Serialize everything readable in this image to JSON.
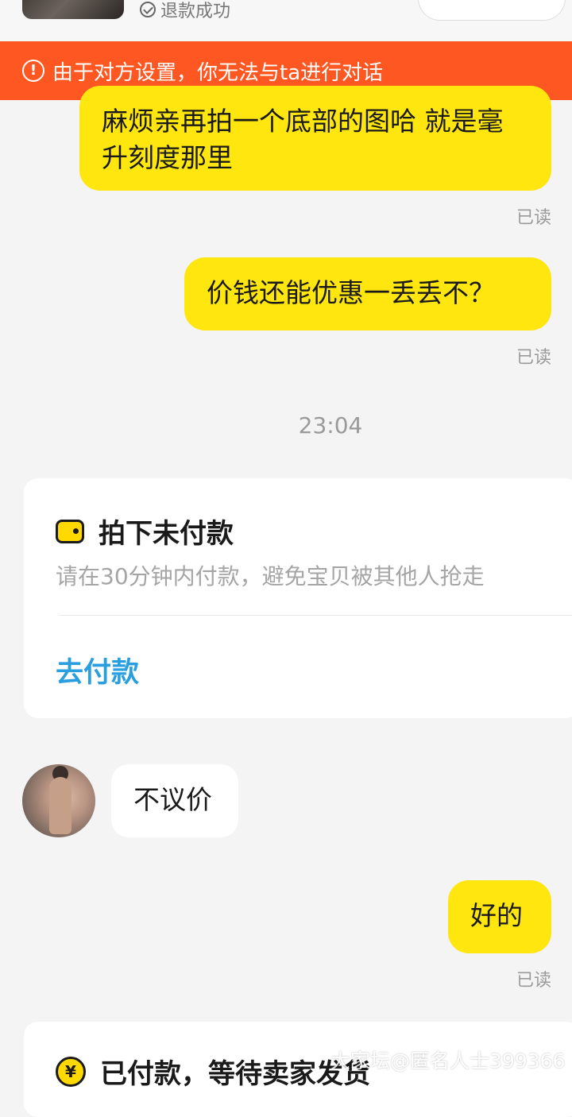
{
  "header": {
    "refund_status": "退款成功"
  },
  "warning_banner": {
    "text": "由于对方设置，你无法与ta进行对话",
    "icon": "alert-circle-icon"
  },
  "messages": [
    {
      "side": "out",
      "text": "麻烦亲再拍一个底部的图哈 就是毫升刻度那里",
      "status": "已读"
    },
    {
      "side": "out",
      "text": "价钱还能优惠一丢丢不？",
      "status": "已读"
    },
    {
      "timestamp": "23:04"
    },
    {
      "card": "order",
      "icon": "wallet-icon",
      "title": "拍下未付款",
      "subtitle": "请在30分钟内付款，避免宝贝被其他人抢走",
      "action": "去付款"
    },
    {
      "side": "in",
      "text": "不议价",
      "avatar": "seller-avatar"
    },
    {
      "side": "out",
      "text": "好的",
      "status": "已读"
    },
    {
      "card": "order",
      "icon": "yen-coin-icon",
      "title": "已付款，等待卖家发货"
    }
  ],
  "colors": {
    "outgoing_bubble": "#ffe60f",
    "warning_bar": "#ff5722",
    "pay_link": "#2a9fe0",
    "background": "#f4f4f4"
  },
  "watermark": "大家坛@匿名人士399366"
}
